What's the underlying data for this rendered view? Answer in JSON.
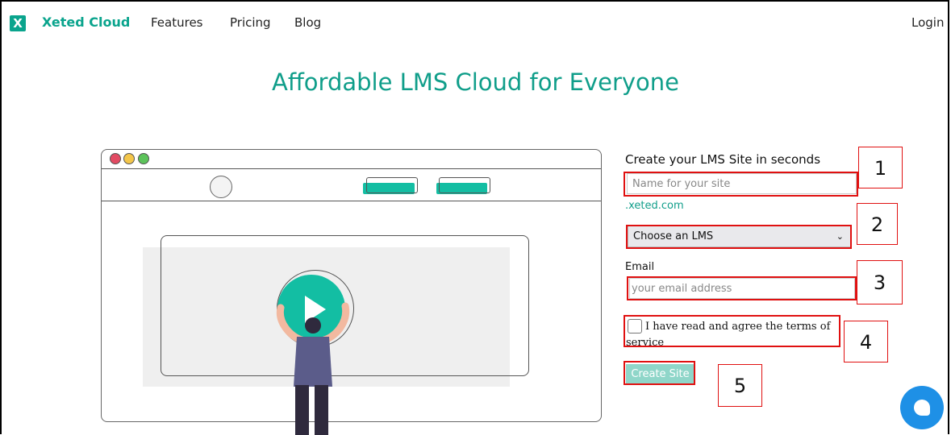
{
  "nav": {
    "logo_glyph": "X",
    "brand": "Xeted Cloud",
    "links": [
      "Features",
      "Pricing",
      "Blog"
    ],
    "login": "Login"
  },
  "hero": {
    "title": "Affordable LMS Cloud for Everyone"
  },
  "form": {
    "title": "Create your LMS Site in seconds",
    "site_placeholder": "Name for your site",
    "site_suffix": ".xeted.com",
    "lms_select": "Choose an LMS",
    "email_label": "Email",
    "email_placeholder": "your email address",
    "terms": "I have read and agree the terms of service",
    "create_button": "Create Site"
  },
  "annotations": [
    "1",
    "2",
    "3",
    "4",
    "5"
  ],
  "colors": {
    "brand": "#0aa48d",
    "accent": "#13bea3",
    "annotation": "#e01010",
    "chat": "#1e90e6"
  },
  "icons": {
    "select_chevron": "chevron-down-icon",
    "chat": "chat-icon",
    "play": "play-icon"
  }
}
